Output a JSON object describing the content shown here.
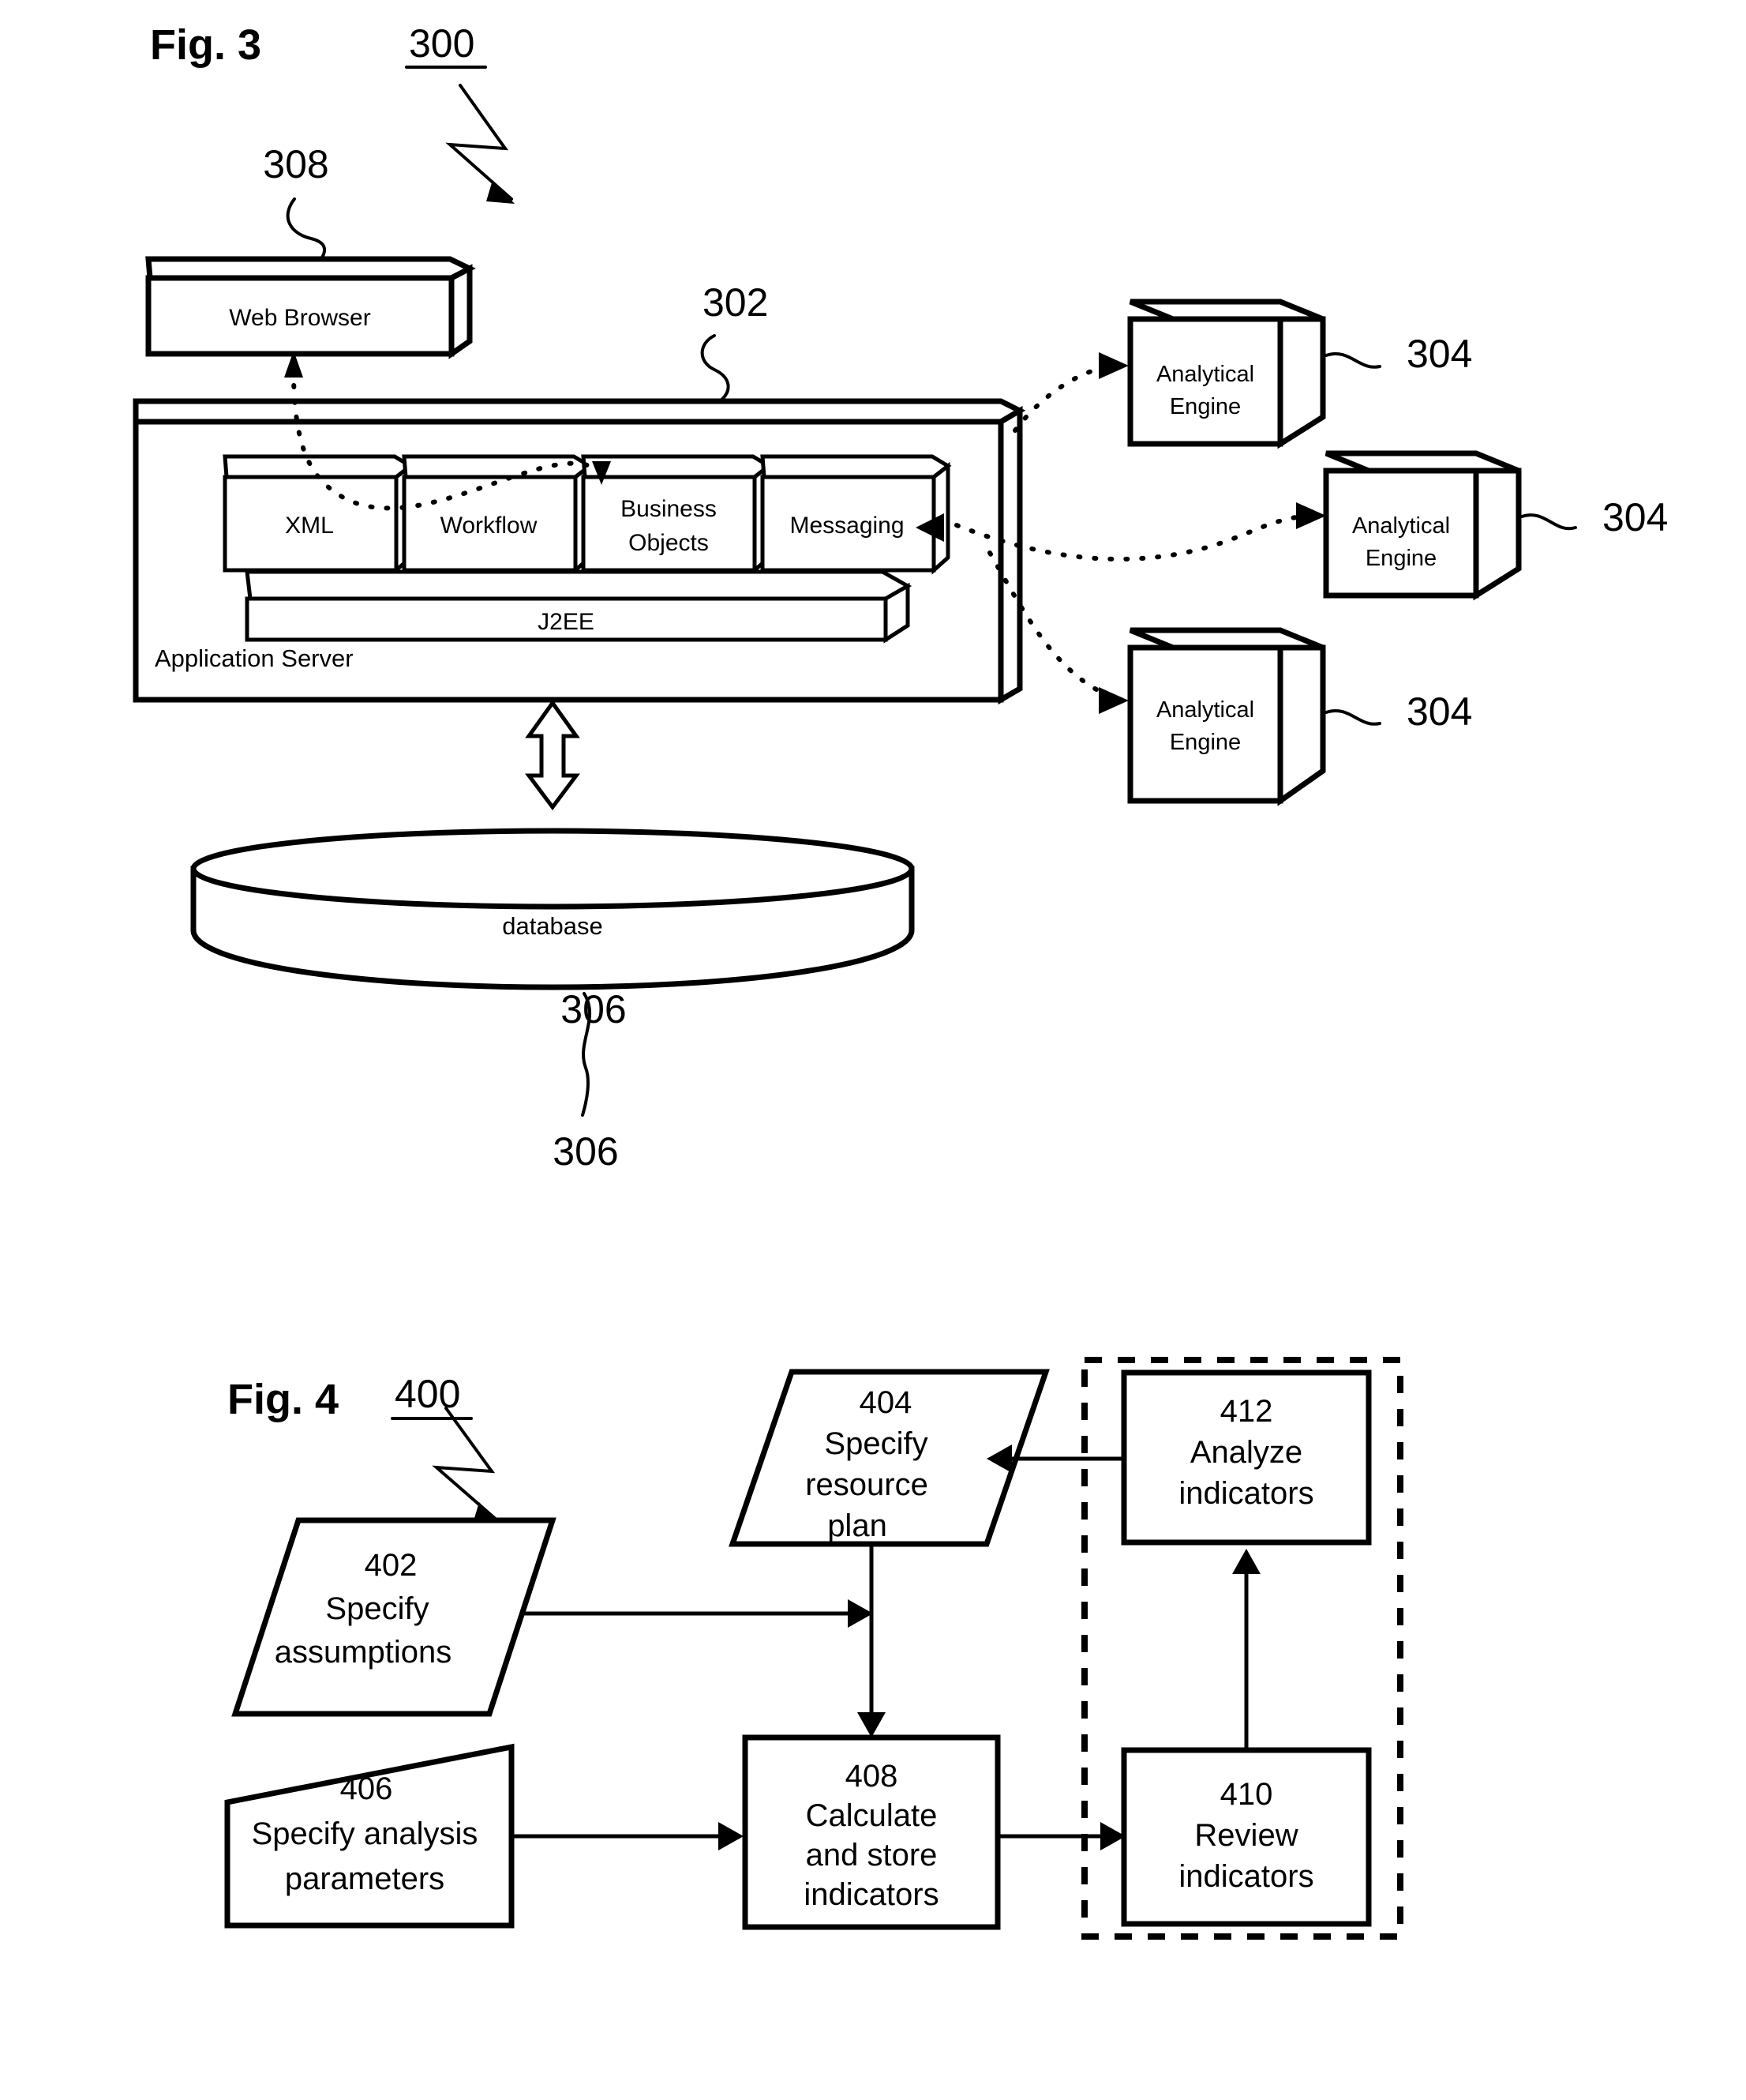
{
  "sheet": {
    "background": "#ffffff",
    "ink": "#000000"
  },
  "figure3": {
    "title": "Fig. 3",
    "ref": "300",
    "nodes": {
      "web_browser": {
        "label": "Web Browser",
        "ref": "308"
      },
      "application_server": {
        "label": "Application Server",
        "ref": "302"
      },
      "modules": [
        {
          "label": "XML"
        },
        {
          "label": "Workflow"
        },
        {
          "label_line1": "Business",
          "label_line2": "Objects"
        },
        {
          "label": "Messaging"
        }
      ],
      "platform": {
        "label": "J2EE"
      },
      "database": {
        "label": "database",
        "ref": "306"
      },
      "analytical_engines": [
        {
          "label_line1": "Analytical",
          "label_line2": "Engine",
          "ref": "304"
        },
        {
          "label_line1": "Analytical",
          "label_line2": "Engine",
          "ref": "304"
        },
        {
          "label_line1": "Analytical",
          "label_line2": "Engine",
          "ref": "304"
        }
      ]
    }
  },
  "figure4": {
    "title": "Fig. 4",
    "ref": "400",
    "steps": [
      {
        "id": "402",
        "shape": "parallelogram",
        "ref": "402",
        "line1": "Specify",
        "line2": "assumptions"
      },
      {
        "id": "404",
        "shape": "parallelogram",
        "ref": "404",
        "line1": "Specify",
        "line2": "resource",
        "line3": "plan"
      },
      {
        "id": "406",
        "shape": "trapezoid",
        "ref": "406",
        "line1": "Specify analysis",
        "line2": "parameters"
      },
      {
        "id": "408",
        "shape": "rectangle",
        "ref": "408",
        "line1": "Calculate",
        "line2": "and store",
        "line3": "indicators"
      },
      {
        "id": "410",
        "shape": "rectangle",
        "ref": "410",
        "line1": "Review",
        "line2": "indicators"
      },
      {
        "id": "412",
        "shape": "rectangle",
        "ref": "412",
        "line1": "Analyze",
        "line2": "indicators"
      }
    ]
  }
}
